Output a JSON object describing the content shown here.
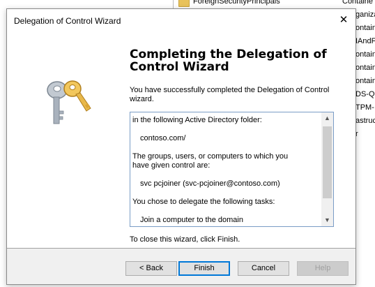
{
  "background": {
    "folder_name": "ForeignSecurityPrincipals",
    "folder_type": "Containe",
    "right_list": [
      "ganiza",
      "ontaine",
      "IAndF",
      "ontaine",
      "ontaine",
      "ontaine",
      "DS-Qu",
      "TPM-",
      "astruc",
      "r"
    ]
  },
  "dialog": {
    "title": "Delegation of Control Wizard",
    "close_glyph": "✕",
    "heading": "Completing the Delegation of Control Wizard",
    "intro": "You have successfully completed the Delegation of Control wizard.",
    "summary_lines": [
      "in the following Active Directory folder:",
      "",
      "    contoso.com/",
      "",
      "The groups, users, or computers to which you",
      "have given control are:",
      "",
      "    svc pcjoiner (svc-pcjoiner@contoso.com)",
      "",
      "You chose to delegate the following tasks:",
      "",
      "    Join a computer to the domain"
    ],
    "finish_note": "To close this wizard, click Finish.",
    "buttons": {
      "back": "< Back",
      "finish": "Finish",
      "cancel": "Cancel",
      "help": "Help"
    }
  },
  "colors": {
    "accent": "#0078d7",
    "key_gold": "#e8b84a",
    "key_silver": "#a9b2bd"
  }
}
